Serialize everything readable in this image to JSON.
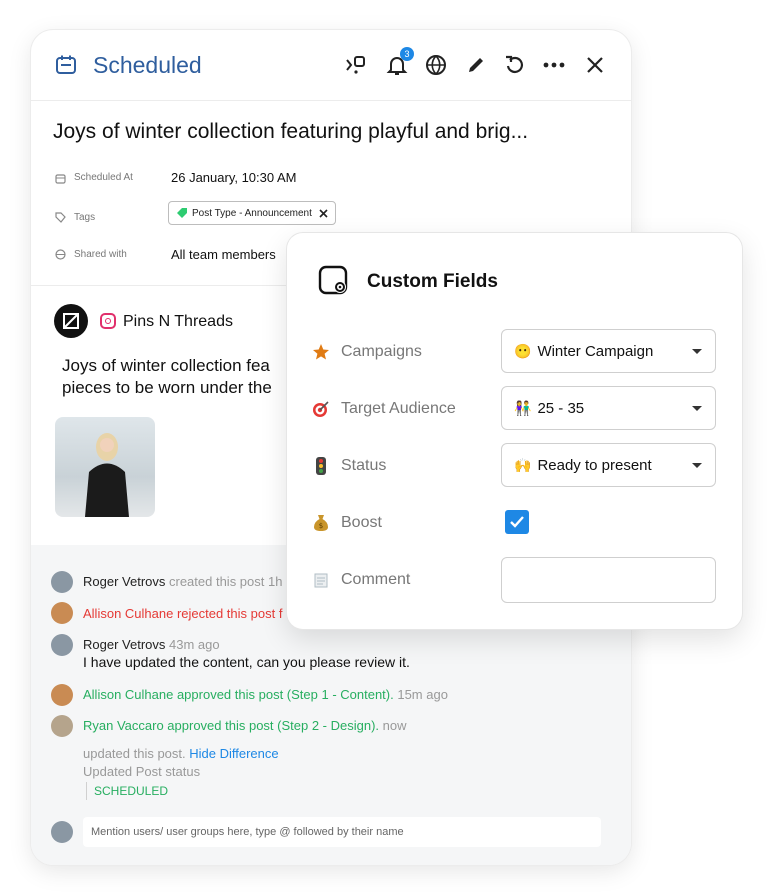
{
  "header": {
    "title": "Scheduled",
    "notification_count": "3"
  },
  "post": {
    "title": "Joys of winter collection featuring playful and brig...",
    "meta": {
      "scheduled_label": "Scheduled At",
      "scheduled_value": "26 January, 10:30 AM",
      "tags_label": "Tags",
      "tag_chip": "Post Type - Announcement",
      "shared_label": "Shared with",
      "shared_value": "All team members"
    },
    "account_name": "Pins N Threads",
    "body_line1": "Joys of winter collection fea",
    "body_line2": "pieces to be worn under the"
  },
  "activity": {
    "a1_name": "Roger Vetrovs",
    "a1_text": " created this post 1h",
    "a2_text": "Allison Culhane rejected this post f",
    "a3_name": "Roger Vetrovs",
    "a3_time": " 43m ago",
    "a3_msg": "I have updated the content, can you please review it.",
    "a4_text": "Allison Culhane approved this post (Step 1 - Content).",
    "a4_time": " 15m ago",
    "a5_text": "Ryan Vaccaro approved this post (Step 2 - Design).",
    "a5_time": " now",
    "updated_text": "updated this post. ",
    "hide_diff": "Hide Difference",
    "status_label": "Updated Post status",
    "status_value": "SCHEDULED",
    "mention_placeholder": "Mention users/ user groups here, type @ followed by their name"
  },
  "custom_fields": {
    "title": "Custom Fields",
    "fields": [
      {
        "label": "Campaigns",
        "icon": "star-icon",
        "value": "Winter Campaign",
        "value_emoji": "😶"
      },
      {
        "label": "Target Audience",
        "icon": "target-icon",
        "value": "25 - 35",
        "value_emoji": "👫"
      },
      {
        "label": "Status",
        "icon": "traffic-light-icon",
        "value": "Ready to present",
        "value_emoji": "🙌"
      },
      {
        "label": "Boost",
        "icon": "money-bag-icon",
        "checked": true
      },
      {
        "label": "Comment",
        "icon": "notepad-icon",
        "value": ""
      }
    ]
  },
  "colors": {
    "accent": "#1e88e5",
    "title_blue": "#2f5e9e",
    "approve_green": "#27ae60",
    "reject_red": "#e53935"
  }
}
